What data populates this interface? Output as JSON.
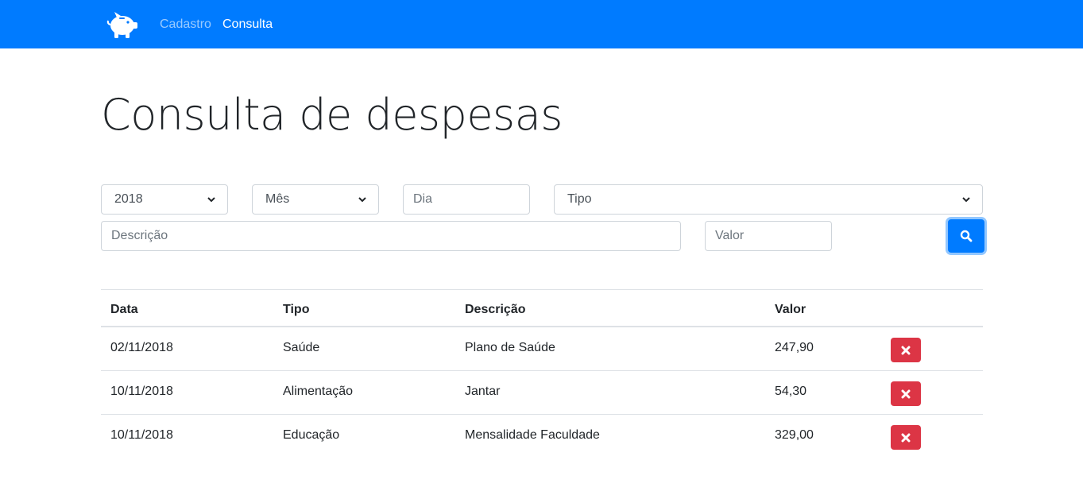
{
  "navbar": {
    "links": [
      {
        "label": "Cadastro",
        "active": false
      },
      {
        "label": "Consulta",
        "active": true
      }
    ],
    "brand_icon": "piggy-bank-icon",
    "color": "#007bff"
  },
  "page": {
    "title": "Consulta de despesas"
  },
  "filters": {
    "ano": "2018",
    "mes_placeholder": "Mês",
    "dia_placeholder": "Dia",
    "tipo_placeholder": "Tipo",
    "descricao_placeholder": "Descrição",
    "valor_placeholder": "Valor",
    "search_icon": "search-icon"
  },
  "table": {
    "headers": {
      "data": "Data",
      "tipo": "Tipo",
      "descricao": "Descrição",
      "valor": "Valor"
    },
    "rows": [
      {
        "data": "02/11/2018",
        "tipo": "Saúde",
        "descricao": "Plano de Saúde",
        "valor": "247,90"
      },
      {
        "data": "10/11/2018",
        "tipo": "Alimentação",
        "descricao": "Jantar",
        "valor": "54,30"
      },
      {
        "data": "10/11/2018",
        "tipo": "Educação",
        "descricao": "Mensalidade Faculdade",
        "valor": "329,00"
      }
    ],
    "delete_icon": "times-icon",
    "delete_color": "#dc3545"
  }
}
